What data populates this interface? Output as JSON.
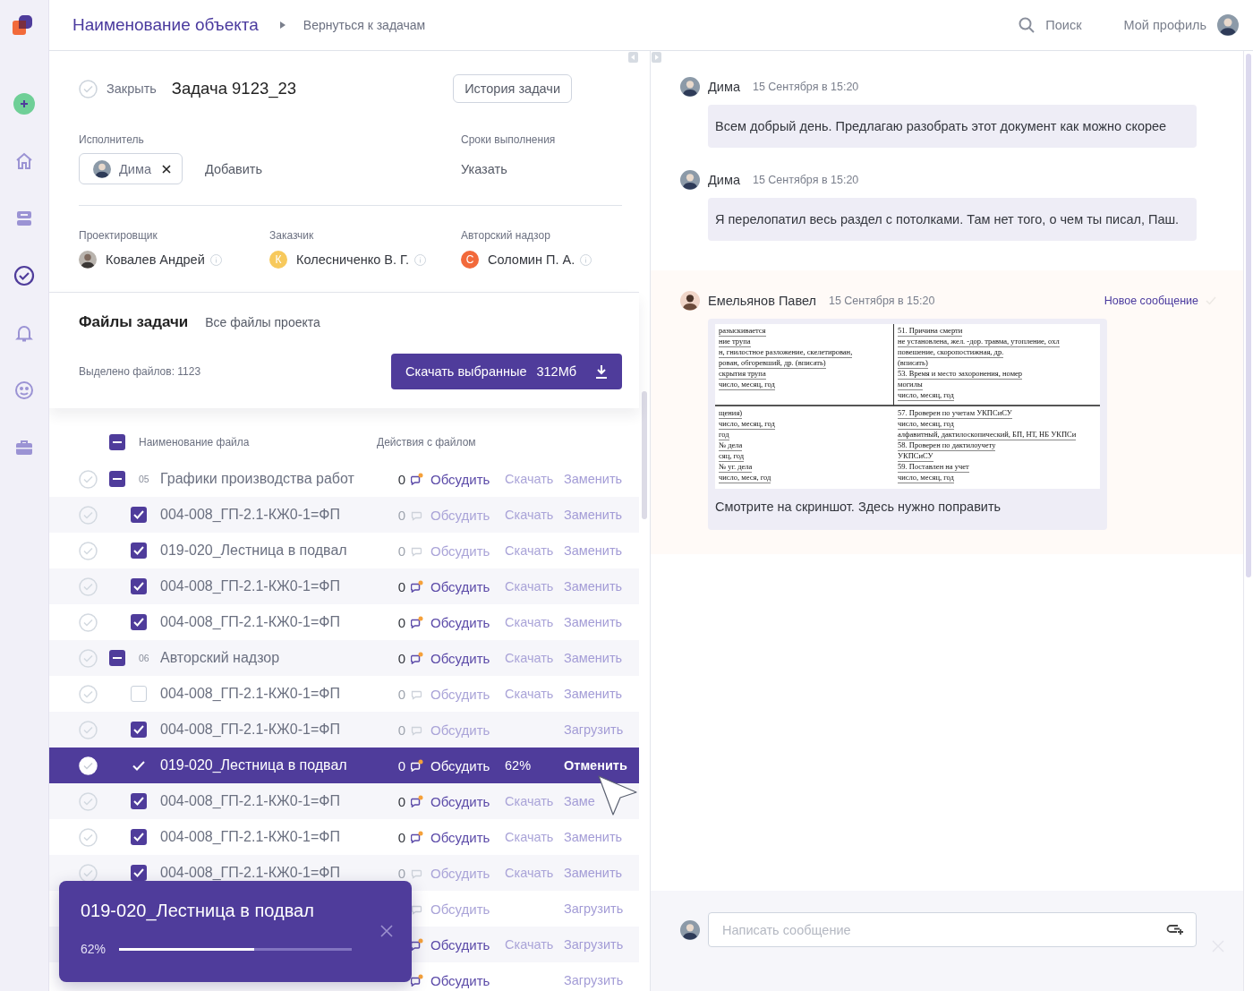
{
  "header": {
    "title": "Наименование объекта",
    "breadcrumb": "Вернуться к задачам",
    "search": "Поиск",
    "profile": "Мой профиль"
  },
  "sidebar": {
    "items": [
      {
        "kind": "add",
        "selected": false
      },
      {
        "kind": "home",
        "selected": false
      },
      {
        "kind": "inbox",
        "selected": false
      },
      {
        "kind": "tasks",
        "selected": true
      },
      {
        "kind": "bell",
        "selected": false
      },
      {
        "kind": "face",
        "selected": false
      },
      {
        "kind": "briefcase",
        "selected": false
      }
    ]
  },
  "task": {
    "close_label": "Закрыть",
    "title": "Задача 9123_23",
    "history_button": "История задачи",
    "assignee_label": "Исполнитель",
    "assignee": "Дима",
    "add_label": "Добавить",
    "deadline_label": "Сроки выполнения",
    "deadline_action": "Указать",
    "roles": [
      {
        "label": "Проектировщик",
        "name": "Ковалев Андрей",
        "kind": "photo"
      },
      {
        "label": "Заказчик",
        "name": "Колесниченко В. Г.",
        "kind": "letter",
        "initial": "К",
        "color": "#f7c95c"
      },
      {
        "label": "Авторский надзор",
        "name": "Соломин П. А.",
        "kind": "letter",
        "initial": "С",
        "color": "#f2693a"
      }
    ]
  },
  "files": {
    "title": "Файлы задачи",
    "all_link": "Все файлы проекта",
    "selected_count": "Выделено файлов: 1123",
    "download_button": "Скачать выбранные",
    "download_size": "312Мб",
    "header_checked": true,
    "header_partial": true,
    "columns": [
      "Наименование файла",
      "Действия с файлом"
    ],
    "rows": [
      {
        "kind": "group",
        "checked": true,
        "partial": true,
        "number": "05",
        "name": "Графики производства работ",
        "count": "0",
        "active": true,
        "discuss": "Обсудить",
        "download": "Скачать",
        "replace": "Заменить",
        "selected": false
      },
      {
        "kind": "file",
        "checked": true,
        "name": "004-008_ГП-2.1-КЖ0-1=ФП",
        "count": "0",
        "active": false,
        "discuss": "Обсудить",
        "download": "Скачать",
        "replace": "Заменить",
        "selected": false
      },
      {
        "kind": "file",
        "checked": true,
        "name": "019-020_Лестница в подвал",
        "count": "0",
        "active": false,
        "discuss": "Обсудить",
        "download": "Скачать",
        "replace": "Заменить",
        "selected": false
      },
      {
        "kind": "file",
        "checked": true,
        "name": "004-008_ГП-2.1-КЖ0-1=ФП",
        "count": "0",
        "active": true,
        "discuss": "Обсудить",
        "download": "Скачать",
        "replace": "Заменить",
        "selected": false
      },
      {
        "kind": "file",
        "checked": true,
        "name": "004-008_ГП-2.1-КЖ0-1=ФП",
        "count": "0",
        "active": true,
        "discuss": "Обсудить",
        "download": "Скачать",
        "replace": "Заменить",
        "selected": false
      },
      {
        "kind": "group",
        "checked": true,
        "partial": true,
        "number": "06",
        "name": "Авторский надзор",
        "count": "0",
        "active": true,
        "discuss": "Обсудить",
        "download": "Скачать",
        "replace": "Заменить",
        "selected": false
      },
      {
        "kind": "file",
        "checked": false,
        "name": "004-008_ГП-2.1-КЖ0-1=ФП",
        "count": "0",
        "active": false,
        "discuss": "Обсудить",
        "download": "Скачать",
        "replace": "Заменить",
        "selected": false
      },
      {
        "kind": "file",
        "checked": true,
        "name": "004-008_ГП-2.1-КЖ0-1=ФП",
        "count": "0",
        "active": false,
        "discuss": "Обсудить",
        "replace": "Загрузить",
        "selected": false
      },
      {
        "kind": "file",
        "checked": true,
        "name": "019-020_Лестница в подвал",
        "count": "0",
        "active": true,
        "discuss": "Обсудить",
        "download": "62%",
        "replace": "Отменить",
        "selected": true
      },
      {
        "kind": "file",
        "checked": true,
        "name": "004-008_ГП-2.1-КЖ0-1=ФП",
        "count": "0",
        "active": true,
        "discuss": "Обсудить",
        "download": "Скачать",
        "replace": "Заме",
        "selected": false
      },
      {
        "kind": "file",
        "checked": true,
        "name": "004-008_ГП-2.1-КЖ0-1=ФП",
        "count": "0",
        "active": true,
        "discuss": "Обсудить",
        "download": "Скачать",
        "replace": "Заменить",
        "selected": false
      },
      {
        "kind": "file",
        "checked": true,
        "name": "004-008_ГП-2.1-КЖ0-1=ФП",
        "count": "0",
        "active": false,
        "discuss": "Обсудить",
        "download": "Скачать",
        "replace": "Заменить",
        "selected": false
      },
      {
        "kind": "file",
        "active": false,
        "discuss": "Обсудить",
        "replace": "Загрузить",
        "selected": false
      },
      {
        "kind": "file",
        "active": true,
        "discuss": "Обсудить",
        "download": "Скачать",
        "replace": "Загрузить",
        "selected": false
      },
      {
        "kind": "file",
        "active": true,
        "discuss": "Обсудить",
        "replace": "Загрузить",
        "selected": false
      }
    ]
  },
  "toast": {
    "title": "019-020_Лестница в подвал",
    "percent": "62%",
    "level": 0.58
  },
  "chat": {
    "messages": [
      {
        "author": "Дима",
        "time": "15 Сентября в 15:20",
        "text": "Всем добрый день. Предлагаю разобрать этот документ как можно скорее"
      },
      {
        "author": "Дима",
        "time": "15 Сентября в 15:20",
        "text": "Я перелопатил весь раздел с потолками. Там нет того, о чем ты писал, Паш."
      },
      {
        "author": "Емельянов Павел",
        "time": "15 Сентября в 15:20",
        "text": "Смотрите на скриншот. Здесь нужно поправить",
        "new": true,
        "new_label": "Новое сообщение",
        "attachment": {
          "kind": "document",
          "blocks": [
            [
              "разыскивается",
              "ние трупа",
              "н, гнилостное разложение, скелетирован,",
              "рован, обгоревший, др. (вписать)",
              "скрытия трупа",
              "число, месяц, год"
            ],
            [
              "51. Причина смерти",
              "не установлена, жел. -дор. травма,  утопление, охл",
              "повешение, скоропостижная, др.",
              "(вписать)",
              "53. Время и место захоронения, номер",
              "могилы",
              "число, месяц, год"
            ],
            [
              "щения)",
              "число, месяц, год",
              "год",
              "№ дела",
              "сяц, год",
              "№ уг. дела",
              "число, меся, год"
            ],
            [
              "57. Проверен по учетам УКПСиСУ",
              "число, месяц, год",
              "алфавитный, дактилоскопический, БП, НТ, НБ УКПСи",
              "58. Проверен по дактилоучету",
              "УКПСиСУ",
              "59. Поставлен на учет",
              "число, месяц, год"
            ]
          ]
        }
      }
    ],
    "composer": {
      "placeholder": "Написать сообщение"
    }
  }
}
